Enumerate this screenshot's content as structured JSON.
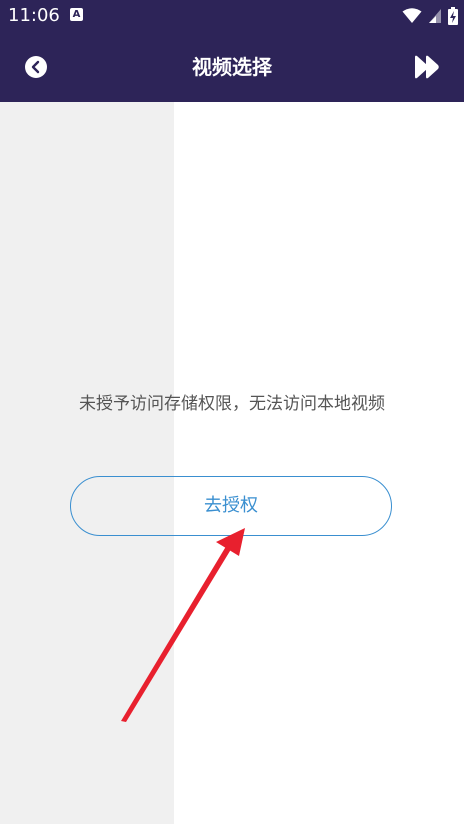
{
  "status_bar": {
    "time": "11:06",
    "app_icon_letter": "A",
    "icons": [
      "wifi-icon",
      "cell-signal-icon",
      "battery-charging-icon"
    ]
  },
  "header": {
    "title": "视频选择",
    "back_icon": "chevron-left-circle-icon",
    "forward_icon": "fast-forward-icon",
    "background_color": "#2d2458"
  },
  "main": {
    "message": "未授予访问存储权限，无法访问本地视频",
    "grant_button_label": "去授权",
    "accent_color": "#3a8fd0",
    "annotation_color": "#e8202e"
  }
}
